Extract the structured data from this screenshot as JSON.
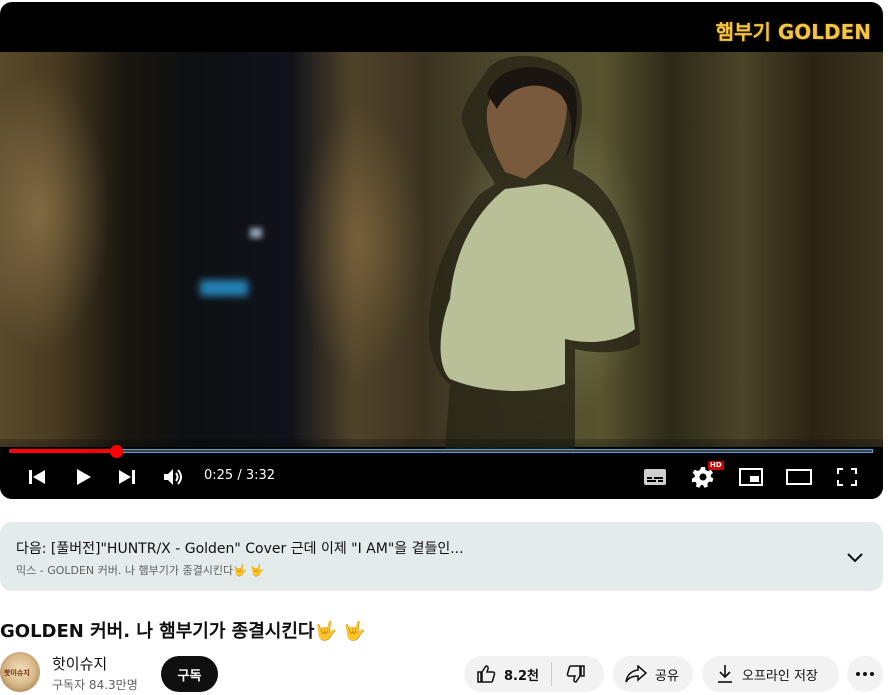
{
  "player": {
    "channel_logo": "햄부기 GOLDEN",
    "time_display": "0:25 / 3:32",
    "progress_fraction": 0.124,
    "hd_badge": "HD"
  },
  "next_panel": {
    "title": "다음: [풀버전]\"HUNTR/X - Golden\" Cover 근데 이제 \"I AM\"을 곁들인...",
    "subtitle": "믹스 - GOLDEN 커버. 나 햄부기가 종결시킨다🤟 🤟"
  },
  "video": {
    "title": "GOLDEN 커버. 나 햄부기가 종결시킨다🤟 🤟"
  },
  "channel": {
    "name": "핫이슈지",
    "subscribers": "구독자 84.3만명",
    "avatar_text": "핫이슈지",
    "subscribe_label": "구독"
  },
  "actions": {
    "like_count": "8.2천",
    "share_label": "공유",
    "offline_label": "오프라인 저장"
  },
  "colors": {
    "progress": "#ff0000",
    "logo": "#f3c542",
    "next_panel_bg": "#e3eceb"
  }
}
